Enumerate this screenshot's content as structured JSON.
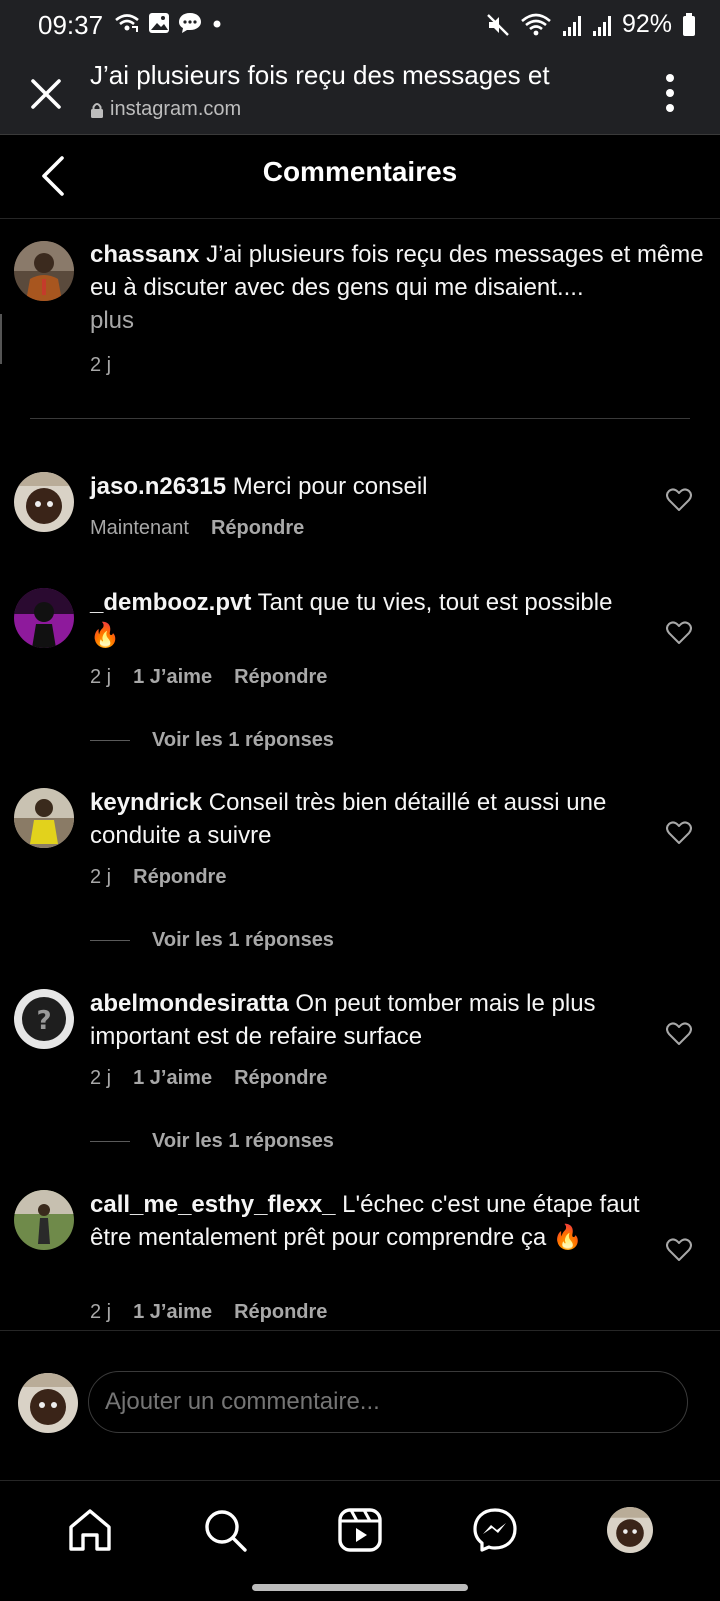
{
  "status_bar": {
    "time": "09:37",
    "battery": "92%",
    "left_icons": [
      "wifi-call-icon",
      "gallery-icon",
      "message-icon",
      "dot-icon"
    ],
    "right_icons": [
      "mute-icon",
      "wifi-icon",
      "signal-icon",
      "signal-icon",
      "battery-icon"
    ]
  },
  "browser": {
    "title": "J’ai plusieurs fois reçu des messages et",
    "url": "instagram.com"
  },
  "header": {
    "title": "Commentaires"
  },
  "caption": {
    "username": "chassanx",
    "text": " J’ai plusieurs fois reçu des messages et même eu à discuter avec des gens qui me disaient....",
    "more": "plus",
    "time": "2 j"
  },
  "comments": [
    {
      "username": "jaso.n26315",
      "text": " Merci pour conseil",
      "time": "Maintenant",
      "likes": "",
      "reply": "Répondre",
      "view_replies": ""
    },
    {
      "username": "_dembooz.pvt",
      "text": " Tant que tu vies, tout est possible 🔥",
      "time": "2 j",
      "likes": "1 J’aime",
      "reply": "Répondre",
      "view_replies": "Voir les 1 réponses"
    },
    {
      "username": "keyndrick",
      "text": " Conseil très bien détaillé et aussi une conduite a suivre",
      "time": "2 j",
      "likes": "",
      "reply": "Répondre",
      "view_replies": "Voir les 1 réponses"
    },
    {
      "username": "abelmondesiratta",
      "text": " On peut tomber mais le plus important est de refaire surface",
      "time": "2 j",
      "likes": "1 J’aime",
      "reply": "Répondre",
      "view_replies": "Voir les 1 réponses"
    },
    {
      "username": "call_me_esthy_flexx_",
      "text": " L'échec c'est une étape faut être mentalement prêt pour comprendre ça 🔥",
      "time": "2 j",
      "likes": "1 J’aime",
      "reply": "Répondre",
      "view_replies": ""
    }
  ],
  "add_comment": {
    "placeholder": "Ajouter un commentaire..."
  },
  "bottom_nav": [
    "home-icon",
    "search-icon",
    "reels-icon",
    "messenger-icon",
    "profile-avatar"
  ]
}
